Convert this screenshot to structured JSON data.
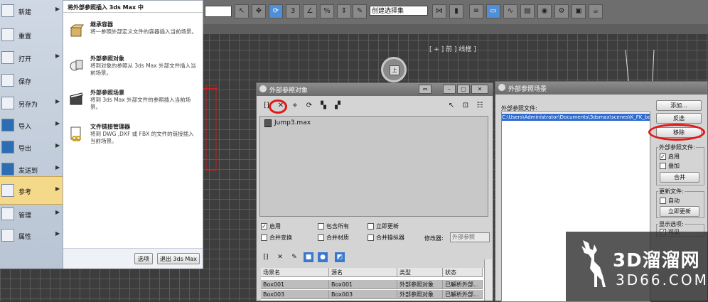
{
  "toolbar": {
    "selection_set": "创建选择集",
    "snap_label": "3"
  },
  "viewport": {
    "label": "[ + ] 前 ] 线框 ]",
    "viewcube_face": "上"
  },
  "app_menu": {
    "items": [
      {
        "label": "新建",
        "icon": "new-file-icon"
      },
      {
        "label": "重置",
        "icon": "reset-icon"
      },
      {
        "label": "打开",
        "icon": "open-folder-icon"
      },
      {
        "label": "保存",
        "icon": "save-disk-icon"
      },
      {
        "label": "另存为",
        "icon": "save-as-icon"
      },
      {
        "label": "导入",
        "icon": "import-icon"
      },
      {
        "label": "导出",
        "icon": "export-icon"
      },
      {
        "label": "发送到",
        "icon": "send-to-icon"
      },
      {
        "label": "参考",
        "icon": "reference-icon"
      },
      {
        "label": "管理",
        "icon": "manage-icon"
      },
      {
        "label": "属性",
        "icon": "properties-icon"
      }
    ],
    "submenu_title": "将外部参照插入 3ds Max 中",
    "entries": [
      {
        "title": "继承容器",
        "desc": "将一参照外部定义文件的容器插入当前场景。",
        "icon": "container-icon"
      },
      {
        "title": "外部参照对象",
        "desc": "将到对象的参照从 3ds Max 外部文件插入当前场景。",
        "icon": "xref-object-icon"
      },
      {
        "title": "外部参照场景",
        "desc": "将到 3ds Max 外部文件的参照插入当前场景。",
        "icon": "xref-scene-icon"
      },
      {
        "title": "文件链接管理器",
        "desc": "将到 DWG ,DXF 或 FBX 的文件的链接插入当前场景。",
        "icon": "file-link-icon"
      }
    ],
    "options_button": "选项",
    "exit_button": "退出 3ds Max"
  },
  "xref_objects": {
    "title": "外部参照对象",
    "file": "Jump3.max",
    "checks": [
      {
        "label": "启用",
        "checked": true
      },
      {
        "label": "包含所有",
        "checked": false
      },
      {
        "label": "立即更新",
        "checked": false
      },
      {
        "label": "合并变换",
        "checked": false
      },
      {
        "label": "合并材质",
        "checked": false
      },
      {
        "label": "合并操纵器",
        "checked": false
      }
    ],
    "modifiers_label": "修改器:",
    "modifiers_value": "外部参照",
    "columns": [
      "场景名",
      "源名",
      "类型",
      "状态"
    ],
    "rows": [
      [
        "Box001",
        "Box001",
        "外部参照对象",
        "已解析外部..."
      ],
      [
        "Box003",
        "Box003",
        "外部参照对象",
        "已解析外部..."
      ]
    ]
  },
  "xref_scenes": {
    "title": "外部参照场景",
    "files_label": "外部参照文件:",
    "file_path": "C:\\Users\\Administrator\\Documents\\3dsmax\\scenes\\K_FK_ba",
    "add_button": "添加...",
    "invert_button": "反选",
    "remove_button": "移除",
    "group_xref_label": "外部参照文件:",
    "enabled_label": "启用",
    "overlay_label": "叠加",
    "merge_button": "合并",
    "update_group_label": "更新文件:",
    "auto_label": "自动",
    "update_now_button": "立即更新",
    "display_group_label": "显示选项:",
    "visible_label": "可见"
  },
  "watermark": {
    "line1": "3D溜溜网",
    "line2": "3D66.COM"
  }
}
